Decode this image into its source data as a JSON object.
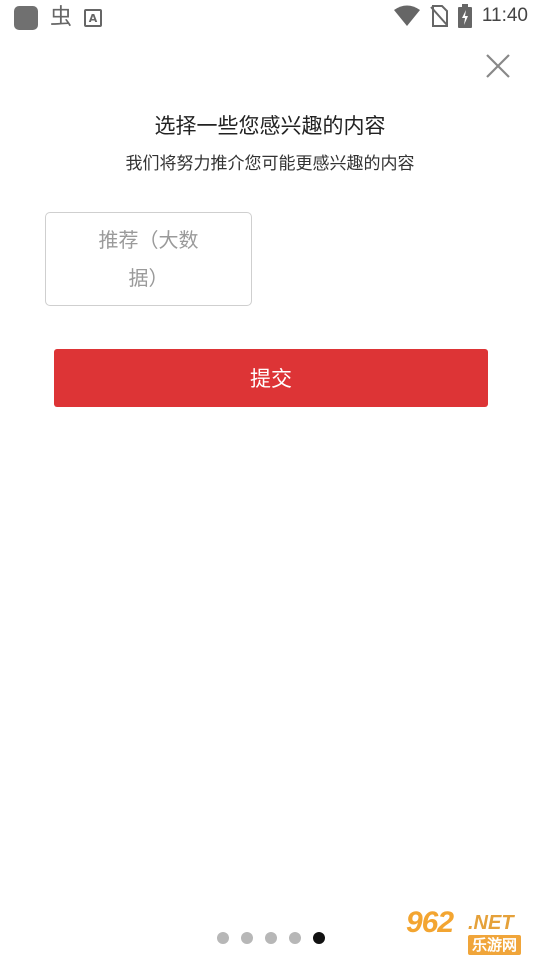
{
  "status_bar": {
    "time": "11:40",
    "left_icons": [
      "app-icon",
      "chong-icon",
      "a-icon"
    ],
    "chong_glyph": "虫",
    "a_glyph": "A",
    "right_icons": [
      "wifi-icon",
      "no-sim-icon",
      "battery-charging-icon"
    ]
  },
  "header": {
    "close_icon": "close-icon",
    "title": "选择一些您感兴趣的内容",
    "subtitle": "我们将努力推介您可能更感兴趣的内容"
  },
  "tags": [
    {
      "label": "推荐（大数据）"
    }
  ],
  "actions": {
    "submit_label": "提交"
  },
  "pager": {
    "total": 5,
    "active_index": 4
  },
  "watermark": {
    "number": "962",
    "suffix": ".NET",
    "site": "乐游网"
  },
  "colors": {
    "accent": "#dd3436",
    "dot_inactive": "#b7b7b7",
    "dot_active": "#111111",
    "tag_text": "#9a9a9a"
  }
}
